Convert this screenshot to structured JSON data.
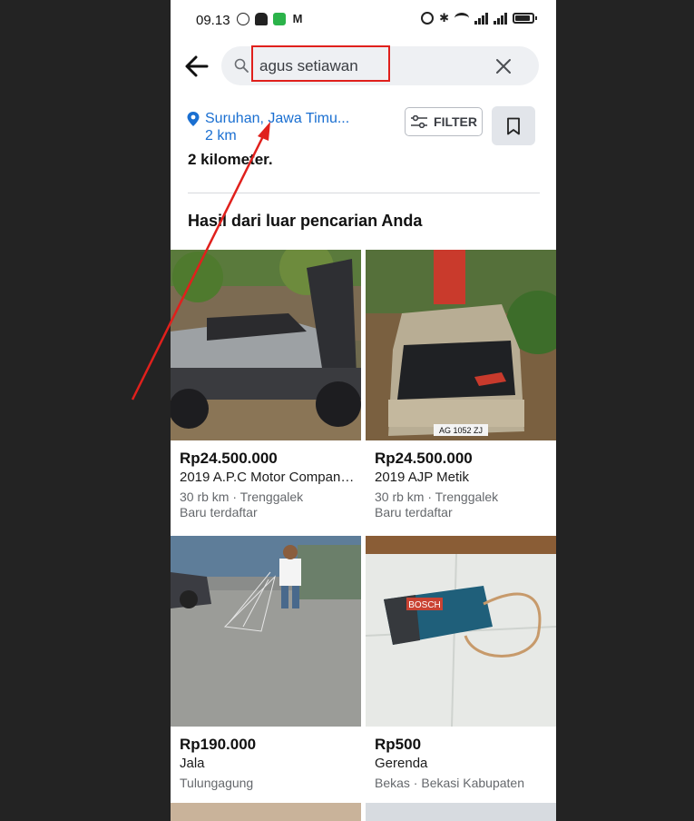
{
  "status_bar": {
    "time": "09.13"
  },
  "search": {
    "query": "agus setiawan"
  },
  "location": {
    "name": "Suruhan, Jawa Timu...",
    "radius": "2 km"
  },
  "filter_label": "FILTER",
  "clipped_text": "2 kilometer.",
  "section_title": "Hasil dari luar pencarian Anda",
  "listings": [
    {
      "price": "Rp24.500.000",
      "title": "2019 A.P.C Motor Company...",
      "meta": "30 rb km · Trenggalek",
      "sub": "Baru terdaftar"
    },
    {
      "price": "Rp24.500.000",
      "title": "2019 AJP Metik",
      "meta": "30 rb km · Trenggalek",
      "sub": "Baru terdaftar"
    },
    {
      "price": "Rp190.000",
      "title": "Jala",
      "meta": "Tulungagung",
      "sub": ""
    },
    {
      "price": "Rp500",
      "title": "Gerenda",
      "meta": "Bekas · Bekasi Kabupaten",
      "sub": ""
    }
  ],
  "photo_text": {
    "plate": "AG 1052 ZJ",
    "brand": "BOSCH"
  },
  "colors": {
    "accent_blue": "#1a6fd1",
    "highlight_red": "#e0201c",
    "backdrop": "#232323"
  }
}
